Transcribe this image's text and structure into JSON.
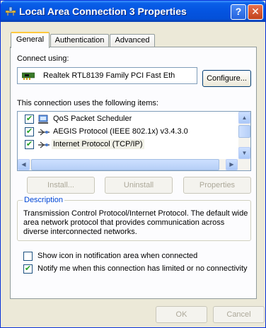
{
  "window": {
    "title": "Local Area Connection 3 Properties",
    "help_label": "?",
    "close_label": "✕"
  },
  "tabs": [
    {
      "label": "General",
      "active": true
    },
    {
      "label": "Authentication",
      "active": false
    },
    {
      "label": "Advanced",
      "active": false
    }
  ],
  "connect_using": {
    "label": "Connect using:",
    "adapter": "Realtek RTL8139 Family PCI Fast Eth",
    "configure_label": "Configure..."
  },
  "items_section": {
    "label": "This connection uses the following items:",
    "items": [
      {
        "label": "QoS Packet Scheduler",
        "checked": true,
        "icon": "scheduler-icon",
        "selected": false
      },
      {
        "label": "AEGIS Protocol (IEEE 802.1x) v3.4.3.0",
        "checked": true,
        "icon": "protocol-icon",
        "selected": false
      },
      {
        "label": "Internet Protocol (TCP/IP)",
        "checked": true,
        "icon": "protocol-icon",
        "selected": true
      }
    ]
  },
  "actions": {
    "install_label": "Install...",
    "uninstall_label": "Uninstall",
    "properties_label": "Properties"
  },
  "description": {
    "title": "Description",
    "text": "Transmission Control Protocol/Internet Protocol. The default wide area network protocol that provides communication across diverse interconnected networks."
  },
  "options": {
    "show_icon_label": "Show icon in notification area when connected",
    "show_icon_checked": false,
    "notify_label": "Notify me when this connection has limited or no connectivity",
    "notify_checked": true
  },
  "footer": {
    "ok_label": "OK",
    "cancel_label": "Cancel"
  },
  "colors": {
    "titlebar": "#0454e0",
    "dialog_bg": "#ece9d8",
    "panel_bg": "#fcfcfe",
    "group_title": "#0046d5"
  }
}
